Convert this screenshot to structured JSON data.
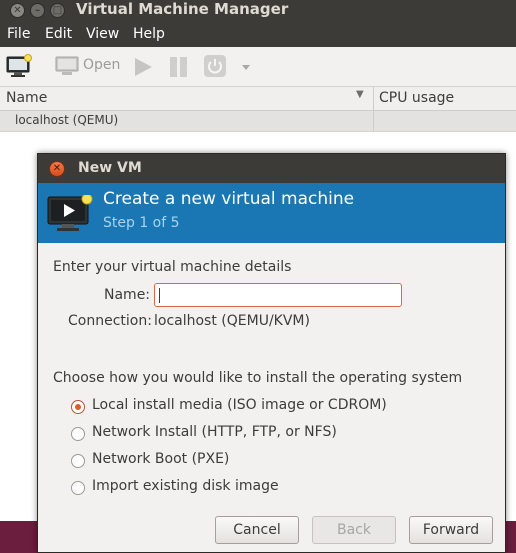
{
  "window": {
    "title": "Virtual Machine Manager",
    "menu": [
      "File",
      "Edit",
      "View",
      "Help"
    ]
  },
  "toolbar": {
    "open_label": "Open",
    "new_vm_icon": "new-vm-icon",
    "run_icon": "play-icon",
    "pause_icon": "pause-icon",
    "power_icon": "power-icon"
  },
  "vm_list": {
    "columns": [
      "Name",
      "CPU usage"
    ],
    "rows": [
      {
        "name": "localhost (QEMU)"
      }
    ]
  },
  "dialog": {
    "title": "New VM",
    "header_title": "Create a new virtual machine",
    "step": "Step 1 of 5",
    "details_heading": "Enter your virtual machine details",
    "name_label": "Name:",
    "name_value": "",
    "connection_label": "Connection:",
    "connection_value": "localhost (QEMU/KVM)",
    "install_heading": "Choose how you would like to install the operating system",
    "install_options": [
      {
        "label": "Local install media (ISO image or CDROM)",
        "selected": true
      },
      {
        "label": "Network Install (HTTP, FTP, or NFS)",
        "selected": false
      },
      {
        "label": "Network Boot (PXE)",
        "selected": false
      },
      {
        "label": "Import existing disk image",
        "selected": false
      }
    ],
    "buttons": {
      "cancel": "Cancel",
      "back": "Back",
      "forward": "Forward"
    }
  },
  "colors": {
    "title_bar": "#3c3b37",
    "banner": "#1a77b4",
    "accent": "#e05a2b"
  }
}
